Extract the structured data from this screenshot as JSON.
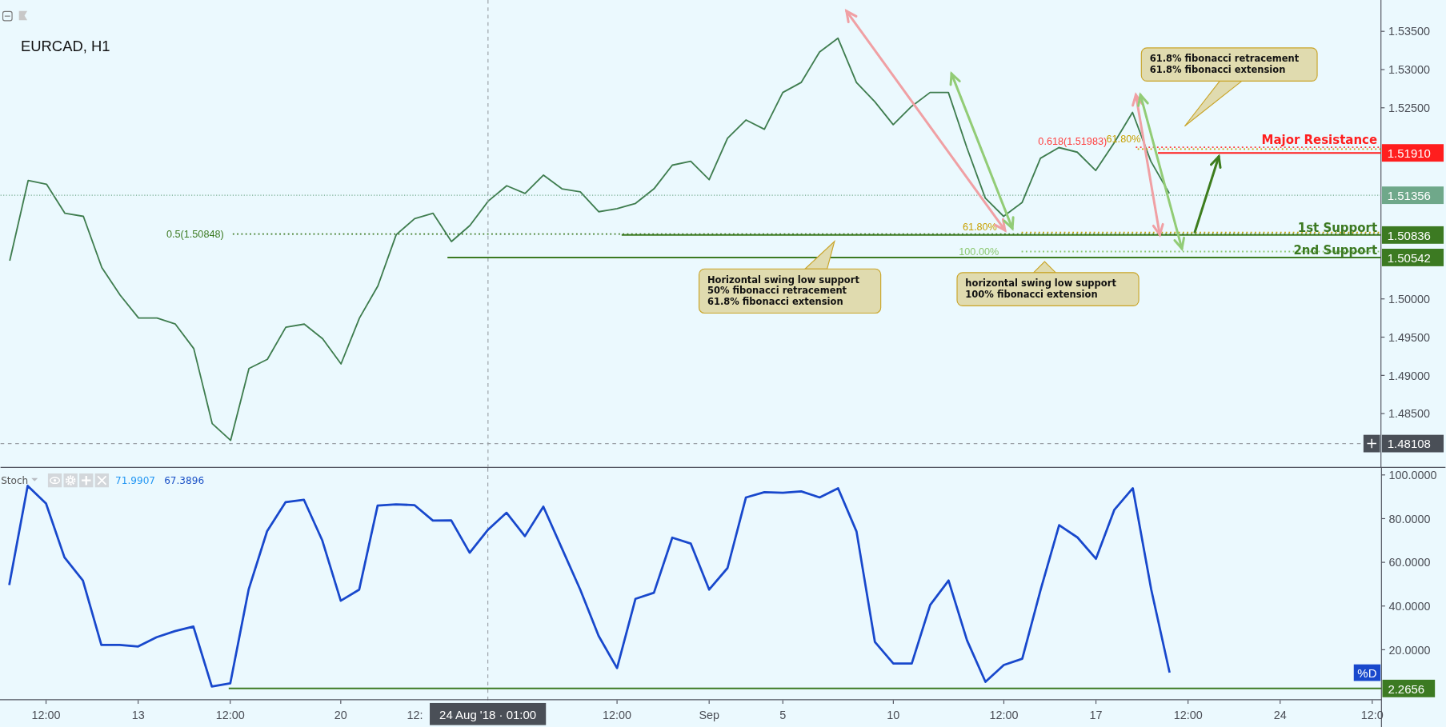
{
  "header": {
    "title": "EURCAD, H1"
  },
  "price_chart": {
    "chart_data": {
      "type": "line",
      "categories": [
        null,
        null,
        null,
        null,
        null,
        null,
        null,
        null,
        null,
        null,
        null,
        null,
        null,
        null,
        null,
        null,
        null,
        null,
        null,
        null,
        null,
        null,
        null,
        null,
        null,
        null,
        null,
        null,
        null,
        null,
        null,
        null,
        null,
        null,
        null,
        null,
        null,
        null,
        null,
        null,
        null,
        null,
        null,
        null,
        null,
        null,
        null,
        null,
        null,
        null,
        null,
        null,
        null,
        null,
        null,
        null,
        null,
        null,
        null,
        null,
        null,
        null,
        null,
        null
      ],
      "series": [
        {
          "color": "#3f7d4f",
          "values": [
            1.505,
            1.5155,
            1.515,
            1.5112,
            1.5108,
            1.5041,
            1.5005,
            1.4975,
            1.4975,
            1.4967,
            1.4935,
            1.4837,
            1.4815,
            1.4909,
            1.4921,
            1.4963,
            1.4967,
            1.4948,
            1.4915,
            1.4975,
            1.5017,
            1.5084,
            1.5105,
            1.5112,
            1.5075,
            1.5096,
            1.5128,
            1.5148,
            1.5138,
            1.5162,
            1.5144,
            1.514,
            1.5114,
            1.5118,
            1.5125,
            1.5144,
            1.5175,
            1.518,
            1.5156,
            1.521,
            1.5234,
            1.5222,
            1.527,
            1.5283,
            1.5323,
            1.5341,
            1.5283,
            1.5258,
            1.5228,
            1.5252,
            1.527,
            1.527,
            1.5198,
            1.5132,
            1.5108,
            1.5126,
            1.5184,
            1.5198,
            1.5192,
            1.5168,
            1.5204,
            1.5244,
            1.518,
            1.5138
          ]
        }
      ],
      "ylim": [
        1.4779,
        1.5391
      ],
      "yticks": [
        {
          "value": 1.535,
          "label": "1.53500"
        },
        {
          "value": 1.53,
          "label": "1.53000"
        },
        {
          "value": 1.525,
          "label": "1.52500"
        },
        {
          "value": 1.5,
          "label": "1.50000"
        },
        {
          "value": 1.495,
          "label": "1.49500"
        },
        {
          "value": 1.49,
          "label": "1.49000"
        },
        {
          "value": 1.485,
          "label": "1.48500"
        }
      ]
    },
    "fib_labels": [
      {
        "text": "0.5(1.50848)",
        "color": "#3c7a22"
      },
      {
        "text": "61.80%",
        "color": "#c8a000"
      },
      {
        "text": "100.00%",
        "color": "#8cc870"
      },
      {
        "text": "0.618(1.51983)",
        "color": "#ff4040"
      },
      {
        "text": "61.80%",
        "color": "#c8a000"
      }
    ],
    "levels": [
      {
        "label": "Major Resistance",
        "color": "#ff1e1e"
      },
      {
        "label": "1st Support",
        "color": "#3c7a22"
      },
      {
        "label": "2nd Support",
        "color": "#3c7a22"
      }
    ],
    "price_badges": [
      {
        "text": "1.51910",
        "color": "#ff1e1e"
      },
      {
        "text": "1.51356",
        "color": "#6fa88a"
      },
      {
        "text": "1.50836",
        "color": "#3c7a22"
      },
      {
        "text": "1.50542",
        "color": "#3c7a22"
      }
    ],
    "cursor_badge": {
      "text": "1.48108"
    },
    "callouts": [
      {
        "lines": [
          "61.8% fibonacci retracement",
          "61.8% fibonacci extension"
        ]
      },
      {
        "lines": [
          "Horizontal swing low support",
          "50% fibonacci retracement",
          "61.8% fibonacci extension"
        ]
      },
      {
        "lines": [
          "horizontal swing low support",
          "100% fibonacci extension"
        ]
      }
    ]
  },
  "indicator": {
    "name": "Stoch",
    "values": [
      {
        "text": "71.9907",
        "color": "#2196f3"
      },
      {
        "text": "67.3896",
        "color": "#1c52c7"
      }
    ],
    "chart_data": {
      "type": "line",
      "categories": [
        null,
        null,
        "12:00",
        null,
        null,
        null,
        null,
        "13",
        null,
        null,
        null,
        null,
        "12:00",
        null,
        null,
        null,
        null,
        null,
        "20",
        null,
        null,
        null,
        null,
        null,
        null,
        null,
        null,
        null,
        null,
        null,
        null,
        null,
        null,
        "12:00",
        null,
        null,
        null,
        null,
        "Sep",
        null,
        null,
        null,
        "5",
        null,
        null,
        null,
        null,
        null,
        "10",
        null,
        null,
        null,
        null,
        null,
        "12:00",
        null,
        null,
        null,
        null,
        "17",
        null,
        null,
        null,
        null,
        "12:00",
        null,
        null,
        null,
        null,
        "24",
        null,
        null,
        null,
        null,
        "12:0"
      ],
      "series": [
        {
          "name": "%D",
          "color": "#1848cc",
          "values": [
            49.6,
            95.0,
            86.9,
            62.3,
            51.7,
            22.2,
            22.2,
            21.5,
            25.7,
            28.5,
            30.6,
            3.2,
            4.6,
            47.5,
            74.2,
            87.5,
            88.6,
            70.0,
            42.4,
            47.5,
            86.0,
            86.5,
            86.2,
            79.1,
            79.2,
            64.4,
            75.0,
            82.7,
            72.0,
            85.5,
            66.5,
            47.5,
            26.4,
            11.6,
            43.3,
            46.1,
            71.3,
            68.6,
            47.5,
            57.4,
            89.7,
            92.1,
            91.8,
            92.5,
            89.7,
            93.9,
            74.1,
            23.6,
            13.7,
            13.7,
            40.5,
            51.7,
            24.3,
            5.3,
            13.0,
            15.9,
            47.5,
            77.0,
            71.4,
            61.6,
            84.1,
            93.9,
            47.7,
            9.5,
            null,
            null,
            null,
            null,
            null,
            null,
            null,
            null,
            null,
            null,
            null
          ]
        }
      ],
      "ylim": [
        -3.1,
        103.2
      ],
      "yticks": [
        {
          "value": 100,
          "label": "100.0000"
        },
        {
          "value": 80,
          "label": "80.0000"
        },
        {
          "value": 60,
          "label": "60.0000"
        },
        {
          "value": 40,
          "label": "40.0000"
        },
        {
          "value": 20,
          "label": "20.0000"
        }
      ]
    },
    "value_badge": {
      "text": "2.2656",
      "color": "#3c7a22"
    }
  },
  "crosshair": {
    "covered_tick": "12:",
    "time_label": "24 Aug '18 · 01:00"
  }
}
